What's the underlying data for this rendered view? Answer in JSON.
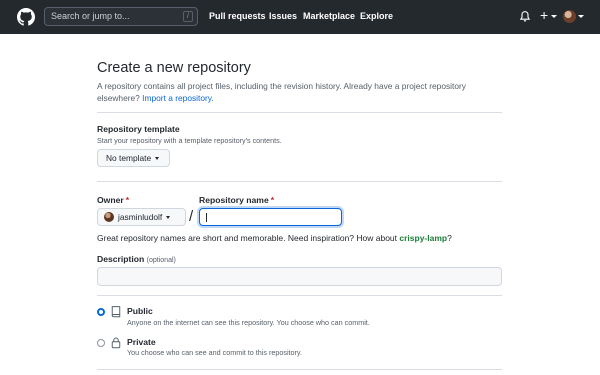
{
  "header": {
    "search_placeholder": "Search or jump to...",
    "search_shortcut": "/",
    "nav": [
      "Pull requests",
      "Issues",
      "Marketplace",
      "Explore"
    ],
    "plus": "+"
  },
  "page": {
    "title": "Create a new repository",
    "intro_text": "A repository contains all project files, including the revision history. Already have a project repository elsewhere?",
    "import_link": "Import a repository."
  },
  "template": {
    "label": "Repository template",
    "hint": "Start your repository with a template repository's contents.",
    "button": "No template"
  },
  "owner": {
    "label": "Owner",
    "required_mark": "*",
    "value": "jasminludolf"
  },
  "slash": "/",
  "repo_name": {
    "label": "Repository name",
    "required_mark": "*",
    "value": ""
  },
  "suggestion": {
    "text": "Great repository names are short and memorable. Need inspiration? How about",
    "name": "crispy-lamp",
    "end": "?"
  },
  "description": {
    "label": "Description",
    "optional": "(optional)",
    "value": ""
  },
  "visibility": {
    "public": {
      "title": "Public",
      "desc": "Anyone on the internet can see this repository. You choose who can commit.",
      "checked": true
    },
    "private": {
      "title": "Private",
      "desc": "You choose who can see and commit to this repository.",
      "checked": false
    }
  },
  "colors": {
    "header_bg": "#24292e",
    "link": "#0969da",
    "suggestion_green": "#1a7f37",
    "required_red": "#cf222e"
  },
  "icons": [
    "github-logo-icon",
    "bell-icon",
    "plus-icon",
    "avatar",
    "repo-icon",
    "lock-icon"
  ]
}
